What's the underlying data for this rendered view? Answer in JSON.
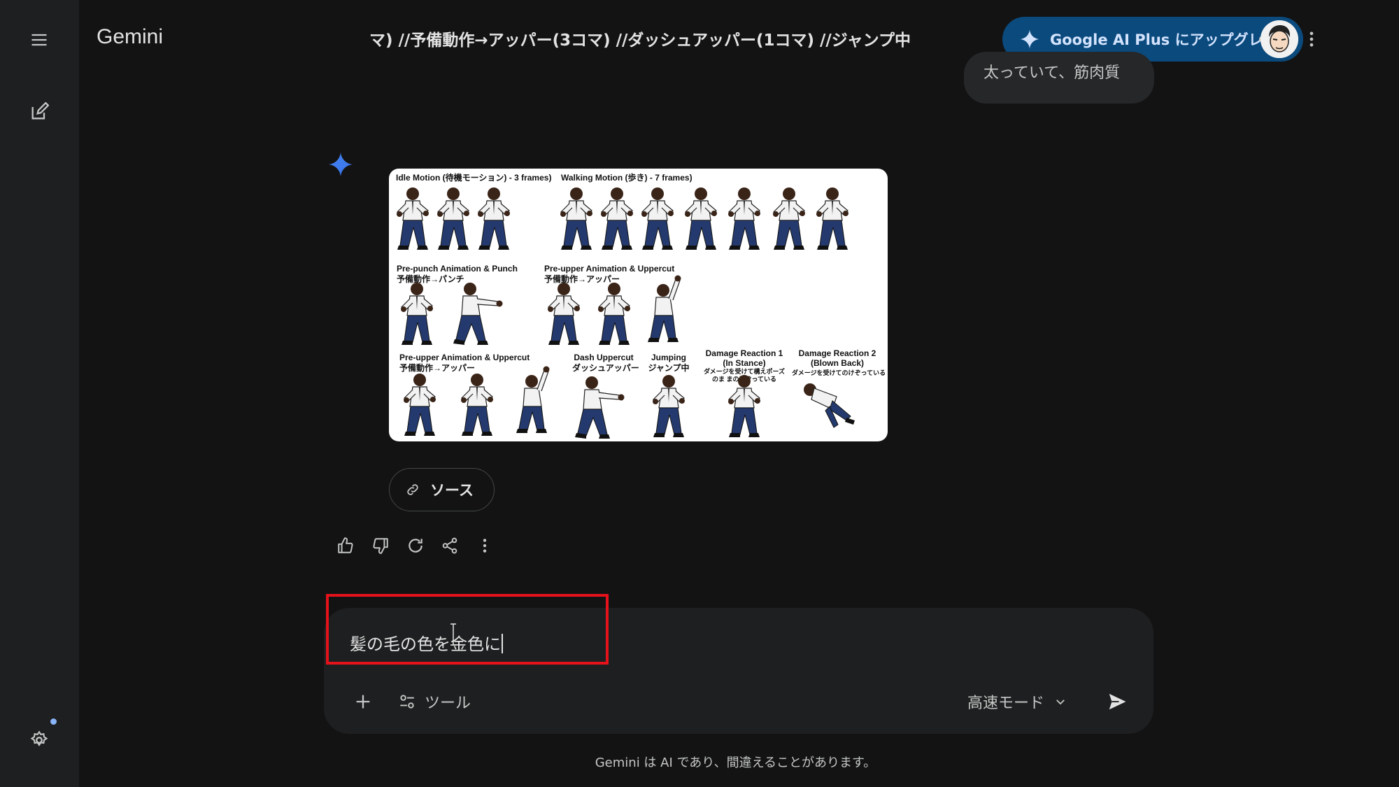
{
  "app": {
    "brand": "Gemini",
    "conversation_title": "マ) //予備動作→アッパー(3コマ) //ダッシュアッパー(1コマ) //ジャンプ中"
  },
  "topbar": {
    "upgrade_label": "Google AI Plus にアップグレード"
  },
  "user_bubble_partial": "太っていて、筋肉質",
  "response": {
    "sprite_sheet": {
      "labels": {
        "idle": "Idle Motion (待機モーション) - 3 frames)",
        "walking": "Walking Motion (歩き) - 7 frames)",
        "prepunch_en": "Pre-punch Animation & Punch",
        "prepunch_jp": "予備動作→パンチ",
        "preupper1_en": "Pre-upper Animation  & Uppercut",
        "preupper1_jp": "予備動作→アッパー",
        "preupper2_en": "Pre-upper Animation & Uppercut",
        "preupper2_jp": "予備動作→アッパー",
        "dash_en": "Dash Uppercut",
        "dash_jp": "ダッシュアッパー",
        "jump_en": "Jumping",
        "jump_jp": "ジャンプ中",
        "dmg1_en": "Damage Reaction 1",
        "dmg1_sub": "(In Stance)",
        "dmg1_jp": "ダメージを受けて構えポーズのま まのけぞっている",
        "dmg2_en": "Damage Reaction 2",
        "dmg2_sub": "(Blown Back)",
        "dmg2_jp": "ダメージを受けてのけぞっている"
      }
    },
    "source_label": "ソース"
  },
  "composer": {
    "input_text": "髪の毛の色を金色に",
    "tools_label": "ツール",
    "mode_label": "高速モード"
  },
  "disclaimer": "Gemini は AI であり、間違えることがあります。",
  "colors": {
    "background": "#131314",
    "rail": "#1e1f20",
    "upgrade_bg": "#0b4a7d",
    "spark_blue": "#4285f4",
    "highlight_red": "#e3121b"
  },
  "icons": {
    "menu": "hamburger-menu-icon",
    "new_chat": "edit-icon",
    "settings": "gear-icon",
    "share": "share-icon",
    "more": "more-vertical-icon",
    "spark": "gemini-spark-icon",
    "link": "link-icon",
    "thumbs_up": "thumbs-up-icon",
    "thumbs_down": "thumbs-down-icon",
    "regenerate": "refresh-icon",
    "plus": "plus-icon",
    "tools": "tune-icon",
    "chevron": "chevron-down-icon",
    "send": "send-icon"
  }
}
